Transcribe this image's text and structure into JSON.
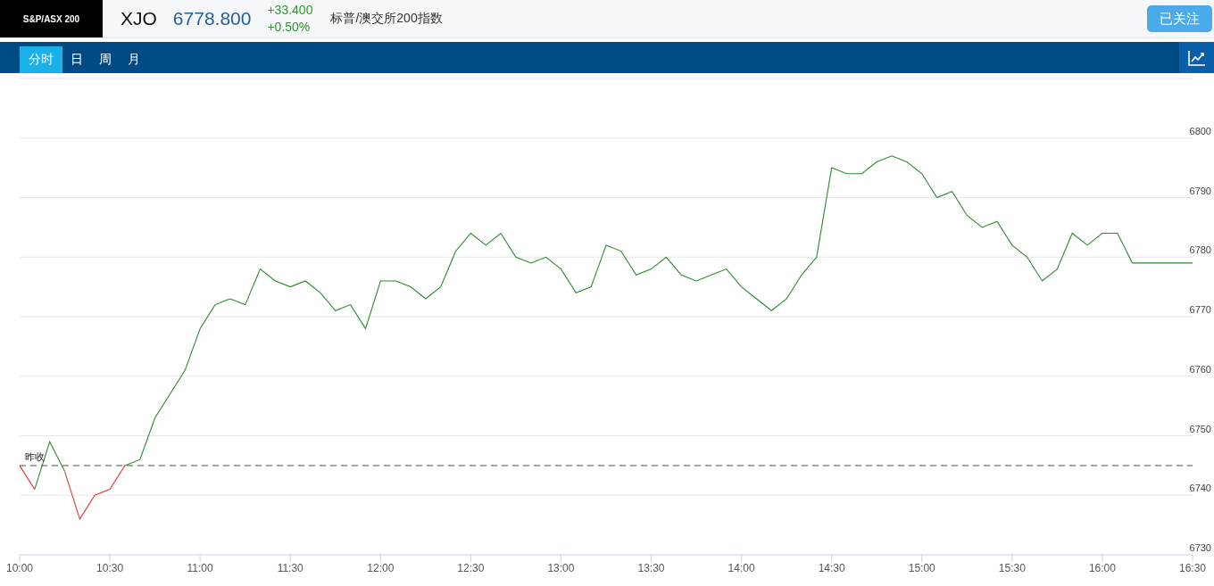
{
  "header": {
    "index_name": "S&P/ASX 200",
    "symbol": "XJO",
    "price": "6778.800",
    "change": "+33.400",
    "change_pct": "+0.50%",
    "description": "标普/澳交所200指数",
    "follow_button": "已关注"
  },
  "tabs": [
    {
      "label": "分时",
      "selected": true
    },
    {
      "label": "日",
      "selected": false
    },
    {
      "label": "周",
      "selected": false
    },
    {
      "label": "月",
      "selected": false
    }
  ],
  "chart": {
    "chart_data": {
      "type": "line",
      "categories": [
        "10:00",
        null,
        null,
        null,
        null,
        null,
        "10:30",
        null,
        null,
        null,
        null,
        null,
        "11:00",
        null,
        null,
        null,
        null,
        null,
        "11:30",
        null,
        null,
        null,
        null,
        null,
        "12:00",
        null,
        null,
        null,
        null,
        null,
        "12:30",
        null,
        null,
        null,
        null,
        null,
        "13:00",
        null,
        null,
        null,
        null,
        null,
        "13:30",
        null,
        null,
        null,
        null,
        null,
        "14:00",
        null,
        null,
        null,
        null,
        null,
        "14:30",
        null,
        null,
        null,
        null,
        null,
        "15:00",
        null,
        null,
        null,
        null,
        null,
        "15:30",
        null,
        null,
        null,
        null,
        null,
        "16:00",
        null,
        null,
        null,
        null,
        null,
        "16:30"
      ],
      "series": [
        {
          "color": "#e53935",
          "values": [
            6745,
            6741,
            null,
            6744,
            6736,
            6740,
            6741,
            6745,
            null,
            null,
            null,
            null,
            null,
            null,
            null,
            null,
            null,
            null,
            null,
            null,
            null,
            null,
            null,
            null,
            null,
            null,
            null,
            null,
            null,
            null,
            null,
            null,
            null,
            null,
            null,
            null,
            null,
            null,
            null,
            null,
            null,
            null,
            null,
            null,
            null,
            null,
            null,
            null,
            null,
            null,
            null,
            null,
            null,
            null,
            null,
            null,
            null,
            null,
            null,
            null,
            null,
            null,
            null,
            null,
            null,
            null,
            null,
            null,
            null,
            null,
            null,
            null,
            null,
            null,
            null,
            null,
            null,
            null,
            null
          ]
        },
        {
          "color": "#2a8a2a",
          "values": [
            null,
            6741,
            6749,
            6744,
            null,
            null,
            null,
            6745,
            6746,
            6753,
            6757,
            6761,
            6768,
            6772,
            6773,
            6772,
            6778,
            6776,
            6775,
            6776,
            6774,
            6771,
            6772,
            6768,
            6776,
            6776,
            6775,
            6773,
            6775,
            6781,
            6784,
            6782,
            6784,
            6780,
            6779,
            6780,
            6778,
            6774,
            6775,
            6782,
            6781,
            6777,
            6778,
            6780,
            6777,
            6776,
            6777,
            6778,
            6775,
            6773,
            6771,
            6773,
            6777,
            6780,
            6795,
            6794,
            6794,
            6796,
            6797,
            6796,
            6794,
            6790,
            6791,
            6787,
            6785,
            6786,
            6782,
            6780,
            6776,
            6778,
            6784,
            6782,
            6784,
            6784,
            6779,
            6779,
            6779,
            6779,
            6779
          ]
        }
      ],
      "ylim": [
        6730,
        6810
      ],
      "yticks": [
        6730,
        6740,
        6750,
        6760,
        6770,
        6780,
        6790,
        6800
      ],
      "grid": true,
      "ref_lines": [
        {
          "axis": "y",
          "value": 6745,
          "label": "昨收"
        }
      ]
    }
  }
}
